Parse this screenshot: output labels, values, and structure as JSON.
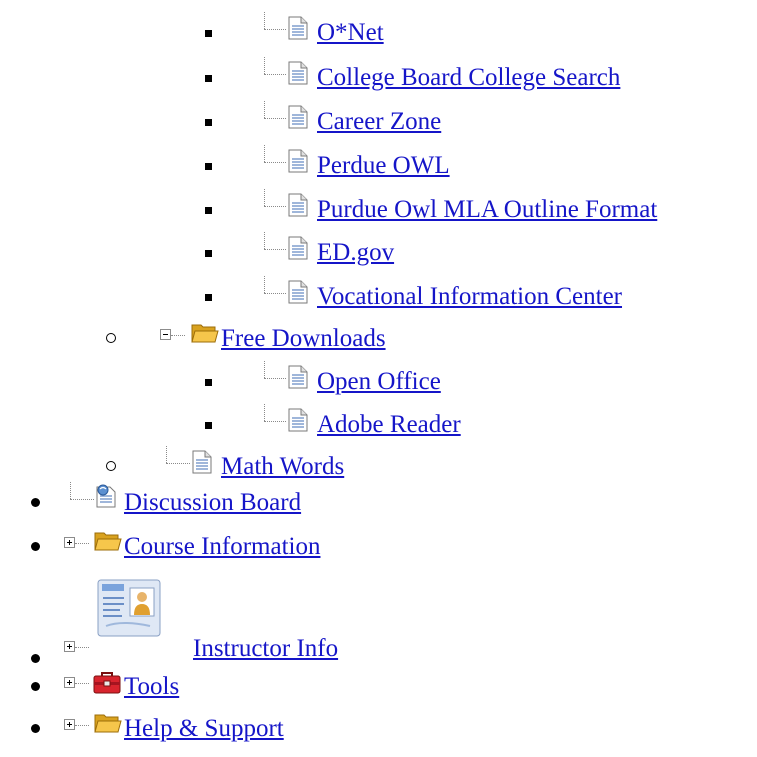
{
  "tree": {
    "resources_children": [
      {
        "label": "O*Net",
        "icon": "document-icon"
      },
      {
        "label": "College Board College Search",
        "icon": "document-icon"
      },
      {
        "label": "Career Zone",
        "icon": "document-icon"
      },
      {
        "label": "Perdue OWL",
        "icon": "document-icon"
      },
      {
        "label": "Purdue Owl MLA Outline Format",
        "icon": "document-icon"
      },
      {
        "label": "ED.gov",
        "icon": "document-icon"
      },
      {
        "label": "Vocational Information Center",
        "icon": "document-icon"
      }
    ],
    "free_downloads": {
      "label": "Free Downloads",
      "icon": "folder-open-icon",
      "expanded": true,
      "children": [
        {
          "label": "Open Office",
          "icon": "document-icon"
        },
        {
          "label": "Adobe Reader",
          "icon": "document-icon"
        }
      ]
    },
    "math_words": {
      "label": "Math Words",
      "icon": "document-icon"
    },
    "top_level": [
      {
        "label": "Discussion Board",
        "icon": "discussion-icon",
        "expandable": false
      },
      {
        "label": "Course Information",
        "icon": "folder-icon",
        "expandable": true
      },
      {
        "label": "Instructor Info",
        "icon": "id-card-icon",
        "expandable": true
      },
      {
        "label": "Tools",
        "icon": "toolbox-icon",
        "expandable": true
      },
      {
        "label": "Help & Support",
        "icon": "folder-icon",
        "expandable": true
      }
    ]
  },
  "colors": {
    "link": "#1515c8",
    "folder": "#f6c64b",
    "toolbox": "#d8242e"
  }
}
